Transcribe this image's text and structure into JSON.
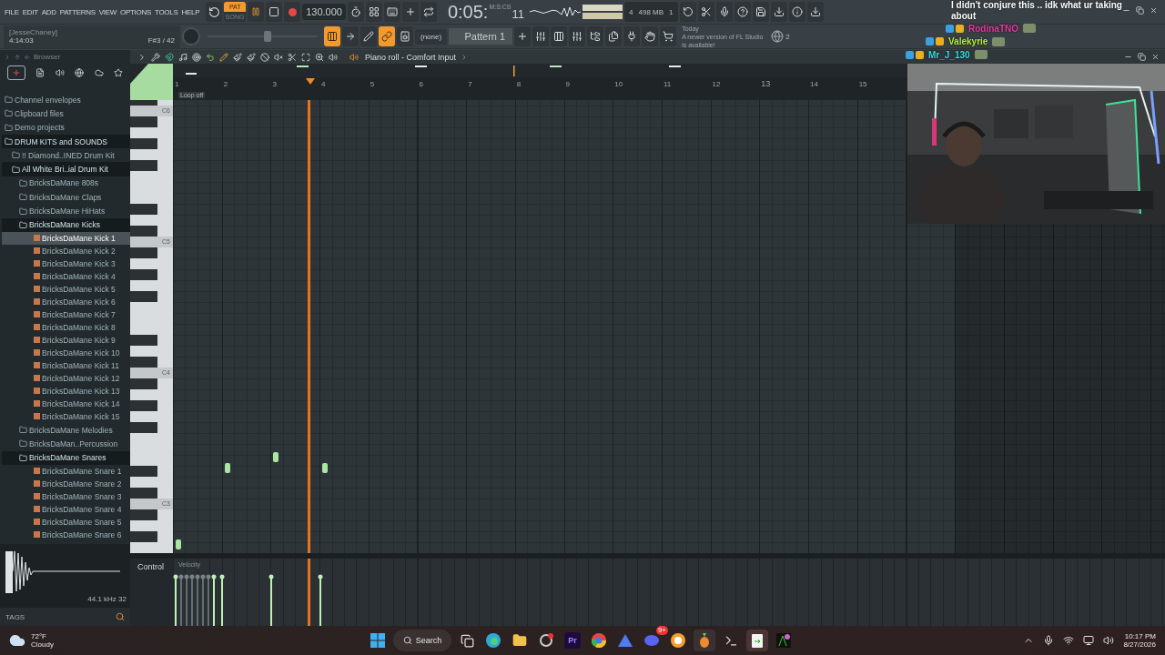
{
  "menu": [
    "FILE",
    "EDIT",
    "ADD",
    "PATTERNS",
    "VIEW",
    "OPTIONS",
    "TOOLS",
    "HELP"
  ],
  "transport": {
    "pat": "PAT",
    "song": "SONG",
    "pattern_mode": true,
    "playing": true,
    "tempo": "130.000"
  },
  "clock": {
    "unit": "M:S:CS",
    "time": "0:05:",
    "centis": "11"
  },
  "pitch_slider": {
    "level": 0.55
  },
  "monitor": {
    "voices": "4",
    "memory": "498 MB",
    "cpu": "1"
  },
  "hint": {
    "user": "[JesseChaney]",
    "time": "4:14:03",
    "note": "F#3 / 42"
  },
  "channel": "(none)",
  "pattern": "Pattern 1",
  "news": {
    "date": "Today",
    "text": "A newer version of FL Studio is available!",
    "count": "2"
  },
  "chat": {
    "lines": [
      "I didn't conjure this .. idk what ur taking",
      "about"
    ],
    "users": [
      {
        "name": "RodinaTNO",
        "color": "#e83aa0"
      },
      {
        "name": "Valekyrie",
        "color": "#b6f23a"
      },
      {
        "name": "Mr_J_130",
        "color": "#2fe0e0"
      }
    ]
  },
  "browser": {
    "title": "Browser",
    "tree": [
      {
        "kind": "folder",
        "label": "Channel envelopes",
        "expanded": false,
        "selected": false
      },
      {
        "kind": "folder",
        "label": "Clipboard files",
        "expanded": false,
        "selected": false
      },
      {
        "kind": "folder",
        "label": "Demo projects",
        "expanded": false,
        "selected": false
      },
      {
        "kind": "folder",
        "label": "DRUM KITS  and SOUNDS",
        "expanded": true,
        "selected": false,
        "children": [
          {
            "kind": "folder",
            "label": "!! Diamond..INED Drum Kit",
            "expanded": false,
            "selected": false
          },
          {
            "kind": "folder",
            "label": "All White Bri..ial Drum Kit",
            "expanded": true,
            "selected": false,
            "children": [
              {
                "kind": "folder",
                "label": "BricksDaMane 808s",
                "expanded": false,
                "selected": false
              },
              {
                "kind": "folder",
                "label": "BricksDaMane Claps",
                "expanded": false,
                "selected": false
              },
              {
                "kind": "folder",
                "label": "BricksDaMane HiHats",
                "expanded": false,
                "selected": false
              },
              {
                "kind": "folder",
                "label": "BricksDaMane Kicks",
                "expanded": true,
                "selected": false,
                "children": [
                  {
                    "kind": "file",
                    "label": "BricksDaMane Kick 1",
                    "selected": true
                  },
                  {
                    "kind": "file",
                    "label": "BricksDaMane Kick 2",
                    "selected": false
                  },
                  {
                    "kind": "file",
                    "label": "BricksDaMane Kick 3",
                    "selected": false
                  },
                  {
                    "kind": "file",
                    "label": "BricksDaMane Kick 4",
                    "selected": false
                  },
                  {
                    "kind": "file",
                    "label": "BricksDaMane Kick 5",
                    "selected": false
                  },
                  {
                    "kind": "file",
                    "label": "BricksDaMane Kick 6",
                    "selected": false
                  },
                  {
                    "kind": "file",
                    "label": "BricksDaMane Kick 7",
                    "selected": false
                  },
                  {
                    "kind": "file",
                    "label": "BricksDaMane Kick 8",
                    "selected": false
                  },
                  {
                    "kind": "file",
                    "label": "BricksDaMane Kick 9",
                    "selected": false
                  },
                  {
                    "kind": "file",
                    "label": "BricksDaMane Kick 10",
                    "selected": false
                  },
                  {
                    "kind": "file",
                    "label": "BricksDaMane Kick 11",
                    "selected": false
                  },
                  {
                    "kind": "file",
                    "label": "BricksDaMane Kick 12",
                    "selected": false
                  },
                  {
                    "kind": "file",
                    "label": "BricksDaMane Kick 13",
                    "selected": false
                  },
                  {
                    "kind": "file",
                    "label": "BricksDaMane Kick 14",
                    "selected": false
                  },
                  {
                    "kind": "file",
                    "label": "BricksDaMane Kick 15",
                    "selected": false
                  }
                ]
              },
              {
                "kind": "folder",
                "label": "BricksDaMane Melodies",
                "expanded": false,
                "selected": false
              },
              {
                "kind": "folder",
                "label": "BricksDaMan..Percussion",
                "expanded": false,
                "selected": false
              },
              {
                "kind": "folder",
                "label": "BricksDaMane Snares",
                "expanded": true,
                "selected": false,
                "children": [
                  {
                    "kind": "file",
                    "label": "BricksDaMane Snare 1",
                    "selected": false
                  },
                  {
                    "kind": "file",
                    "label": "BricksDaMane Snare 2",
                    "selected": false
                  },
                  {
                    "kind": "file",
                    "label": "BricksDaMane Snare 3",
                    "selected": false
                  },
                  {
                    "kind": "file",
                    "label": "BricksDaMane Snare 4",
                    "selected": false
                  },
                  {
                    "kind": "file",
                    "label": "BricksDaMane Snare 5",
                    "selected": false
                  },
                  {
                    "kind": "file",
                    "label": "BricksDaMane Snare 6",
                    "selected": false
                  }
                ]
              }
            ]
          }
        ]
      }
    ],
    "sample_info": "44.1 kHz 32",
    "tags": "TAGS"
  },
  "piano_roll": {
    "title": "Piano roll - Comfort Input",
    "ruler": [
      "1",
      "2",
      "3",
      "4",
      "5",
      "6",
      "7",
      "8",
      "9",
      "10",
      "11",
      "12",
      "13",
      "14",
      "15"
    ],
    "loop": "Loop off",
    "octaves": [
      "C6",
      "C5",
      "C4",
      "C3"
    ],
    "control": "Control",
    "control_target": "Velocity"
  },
  "taskbar": {
    "temperature": "72°F",
    "weather": "Cloudy",
    "search": "Search",
    "premiere": "Pr",
    "badge": "9+",
    "time": "10:17 PM",
    "date": "8/27/2026"
  }
}
